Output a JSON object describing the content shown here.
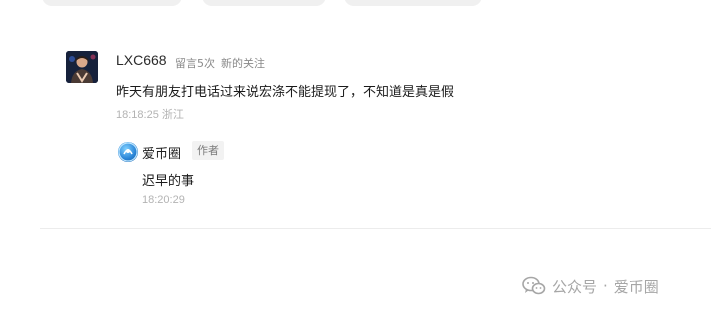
{
  "comment": {
    "username": "LXC668",
    "badges": [
      "留言5次",
      "新的关注"
    ],
    "text": "昨天有朋友打电话过来说宏涤不能提现了，不知道是真是假",
    "time": "18:18:25",
    "location": "浙江"
  },
  "reply": {
    "name": "爱币圈",
    "author_tag": "作者",
    "text": "迟早的事",
    "time": "18:20:29"
  },
  "watermark": {
    "label": "公众号",
    "separator": "·",
    "account": "爱币圈"
  },
  "colors": {
    "meta_gray": "#b3b3b3",
    "tag_bg": "#f2f2f2",
    "divider": "#ececec"
  }
}
